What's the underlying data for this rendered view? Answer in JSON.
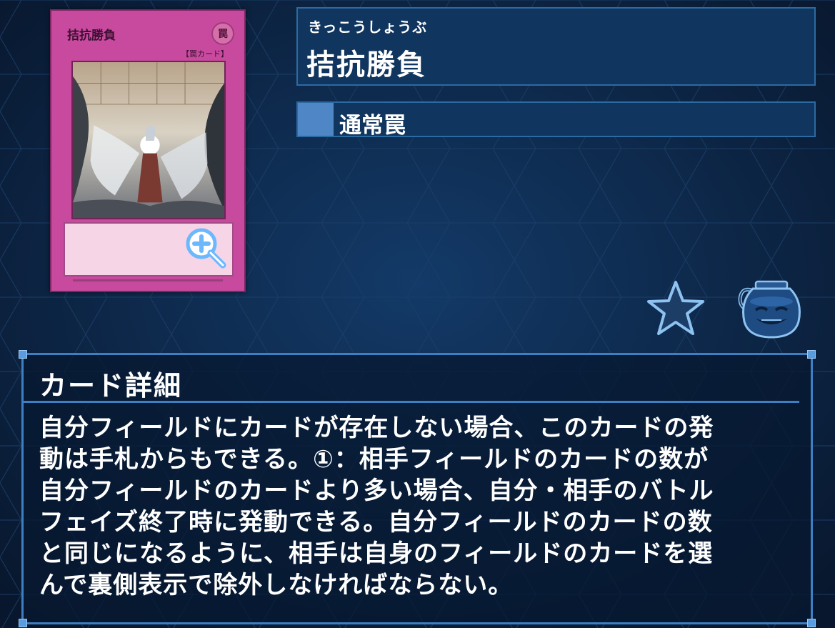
{
  "card": {
    "name": "拮抗勝負",
    "attribute_glyph": "罠",
    "type_bracket": "【罠カード】",
    "frame_color": "#c84a9e"
  },
  "header": {
    "reading": "きっこうしょうぶ",
    "title": "拮抗勝負",
    "card_type": "通常罠"
  },
  "icons": {
    "zoom": "zoom-in-icon",
    "favorite": "star-icon",
    "pot": "pot-of-greed-icon"
  },
  "detail": {
    "heading": "カード詳細",
    "text": "自分フィールドにカードが存在しない場合、このカードの発\n動は手札からもできる。①：相手フィールドのカードの数が\n自分フィールドのカードより多い場合、自分・相手のバトル\nフェイズ終了時に発動できる。自分フィールドのカードの数\nと同じになるように、相手は自身のフィールドのカードを選\nんで裏側表示で除外しなければならない。"
  },
  "colors": {
    "background": "#0b1f3a",
    "panel": "#10355e",
    "panel_border": "#2c6aa2",
    "accent": "#4f86c5"
  }
}
